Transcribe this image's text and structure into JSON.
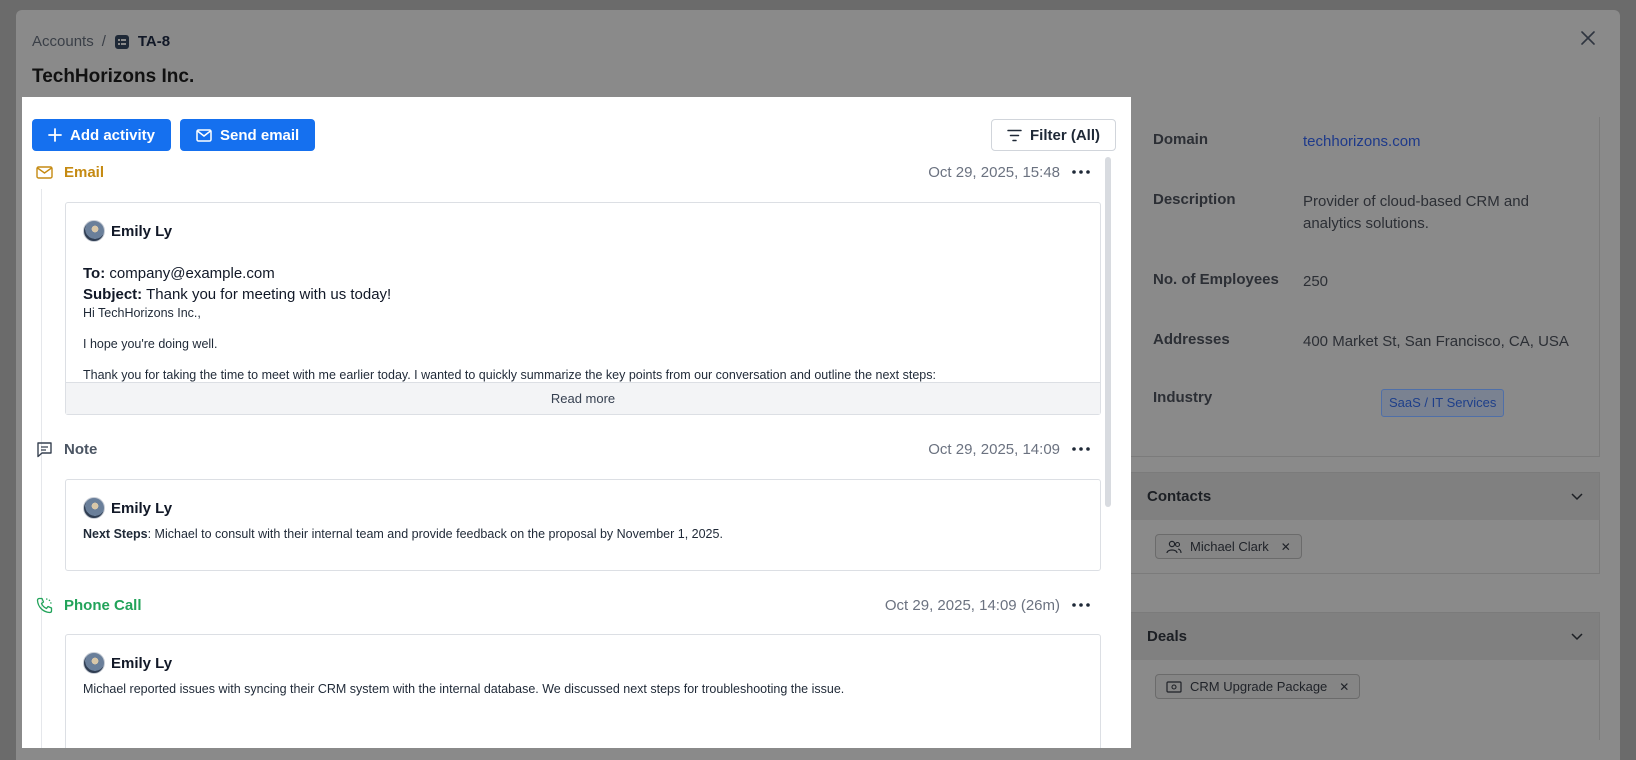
{
  "breadcrumb": {
    "parent": "Accounts",
    "separator": "/",
    "current": "TA-8"
  },
  "page_title": "TechHorizons Inc.",
  "toolbar": {
    "add_activity": "Add activity",
    "send_email": "Send email",
    "filter": "Filter (All)"
  },
  "activities": {
    "email": {
      "type": "Email",
      "time": "Oct 29, 2025, 15:48",
      "author": "Emily Ly",
      "to_label": "To:",
      "to_value": "company@example.com",
      "subject_label": "Subject:",
      "subject_value": "Thank you for meeting with us today!",
      "greeting": "Hi TechHorizons Inc.,",
      "line1": "I hope you're doing well.",
      "line2": "Thank you for taking the time to meet with me earlier today. I wanted to quickly summarize the key points from our conversation and outline the next steps:",
      "read_more": "Read more"
    },
    "note": {
      "type": "Note",
      "time": "Oct 29, 2025, 14:09",
      "author": "Emily Ly",
      "label": "Next Steps",
      "text": ": Michael to consult with their internal team and provide feedback on the proposal by November 1, 2025."
    },
    "call": {
      "type": "Phone Call",
      "time": "Oct 29, 2025, 14:09 (26m)",
      "author": "Emily Ly",
      "text": "Michael reported issues with syncing their CRM system with the internal database. We discussed next steps for troubleshooting the issue."
    }
  },
  "details": {
    "domain_label": "Domain",
    "domain_value": "techhorizons.com",
    "description_label": "Description",
    "description_value": "Provider of cloud-based CRM and analytics solutions.",
    "employees_label": "No. of Employees",
    "employees_value": "250",
    "addresses_label": "Addresses",
    "addresses_value": "400 Market St, San Francisco, CA, USA",
    "industry_label": "Industry",
    "industry_value": "SaaS / IT Services"
  },
  "contacts": {
    "title": "Contacts",
    "chip": "Michael Clark"
  },
  "deals": {
    "title": "Deals",
    "chip": "CRM Upgrade Package"
  },
  "colors": {
    "primary": "#1570ef",
    "email": "#c58a12",
    "call": "#22a35a"
  }
}
